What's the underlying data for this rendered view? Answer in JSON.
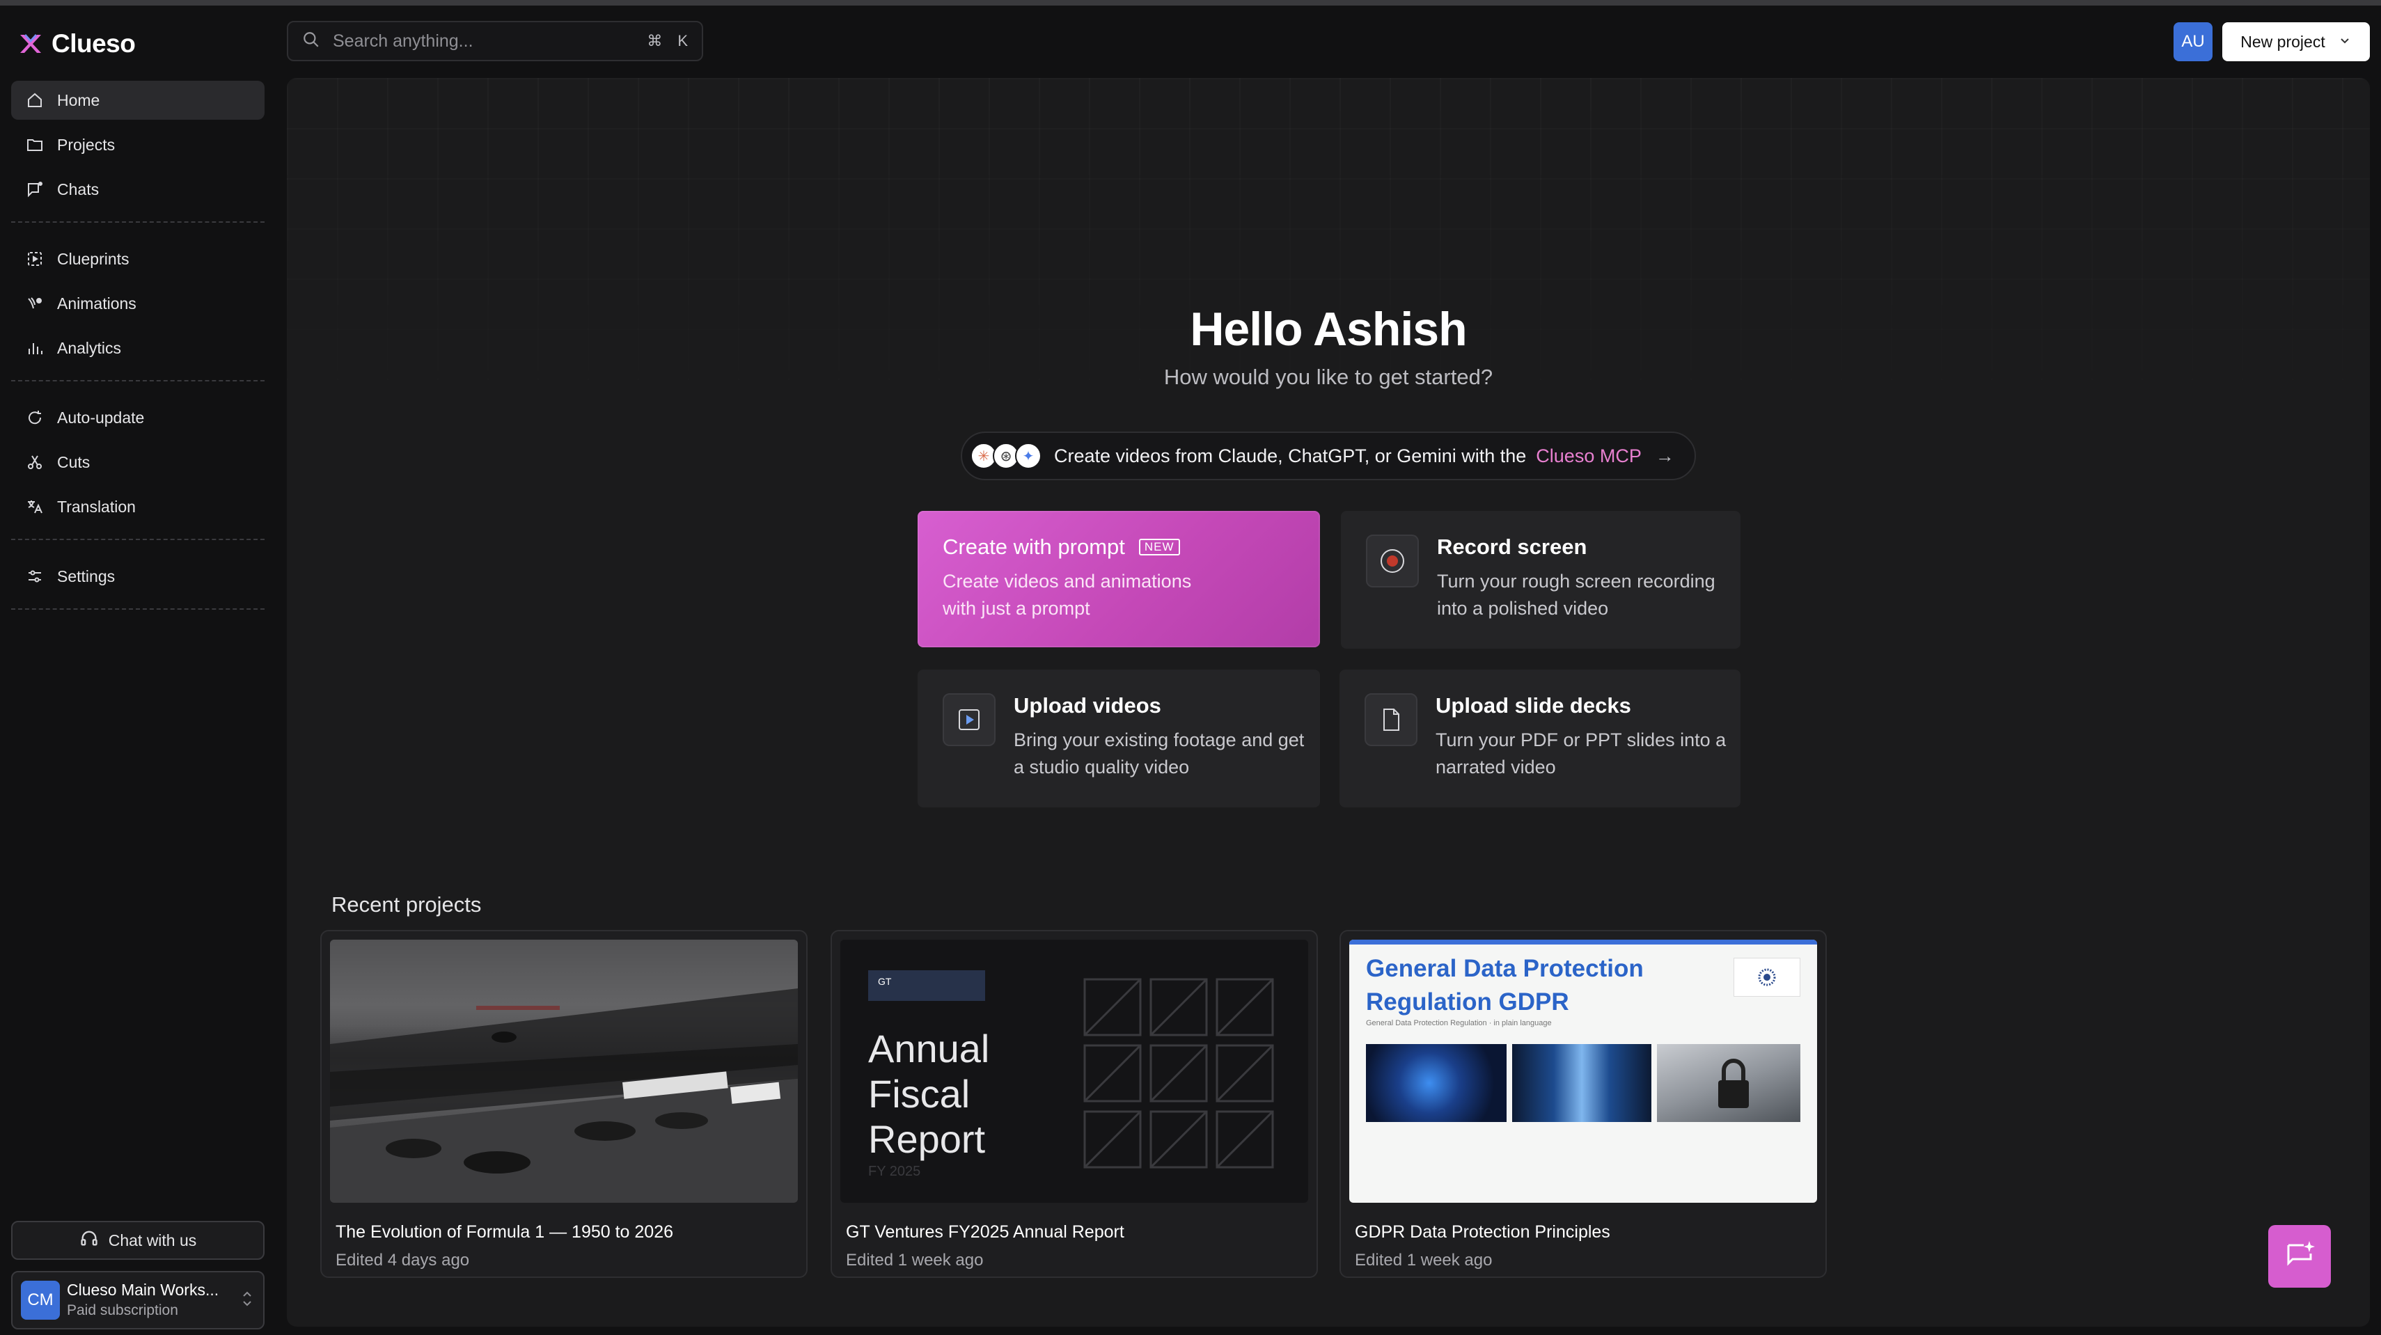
{
  "app": {
    "name": "Clueso"
  },
  "sidebar": {
    "items": [
      {
        "label": "Home",
        "icon": "home-icon",
        "active": true
      },
      {
        "label": "Projects",
        "icon": "folder-icon"
      },
      {
        "label": "Chats",
        "icon": "chat-icon"
      },
      {
        "label": "Clueprints",
        "icon": "clueprint-icon"
      },
      {
        "label": "Animations",
        "icon": "animation-icon"
      },
      {
        "label": "Analytics",
        "icon": "analytics-icon"
      },
      {
        "label": "Auto-update",
        "icon": "refresh-icon"
      },
      {
        "label": "Cuts",
        "icon": "scissors-icon"
      },
      {
        "label": "Translation",
        "icon": "translate-icon"
      },
      {
        "label": "Settings",
        "icon": "sliders-icon"
      }
    ],
    "chat_button": "Chat with us",
    "workspace": {
      "initials": "CM",
      "name": "Clueso Main Works...",
      "plan": "Paid subscription"
    }
  },
  "topbar": {
    "search_placeholder": "Search anything...",
    "shortcut_cmd": "⌘",
    "shortcut_key": "K",
    "user_initials": "AU",
    "new_project_label": "New project"
  },
  "hero": {
    "greeting": "Hello Ashish",
    "subtitle": "How would you like to get started?",
    "mcp_text": "Create videos from Claude, ChatGPT, or Gemini with the",
    "mcp_link": "Clueso MCP"
  },
  "actions": {
    "prompt": {
      "title": "Create with prompt",
      "badge": "NEW",
      "desc": "Create videos and animations with just a prompt"
    },
    "record": {
      "title": "Record screen",
      "desc": "Turn your rough screen recording into a polished video"
    },
    "upload_videos": {
      "title": "Upload videos",
      "desc": "Bring your existing footage and get a studio quality video"
    },
    "upload_slides": {
      "title": "Upload slide decks",
      "desc": "Turn your PDF or PPT slides into a narrated video"
    }
  },
  "recent": {
    "title": "Recent projects",
    "projects": [
      {
        "name": "The Evolution of Formula 1 — 1950 to 2026",
        "edited": "Edited 4 days ago"
      },
      {
        "name": "GT Ventures FY2025 Annual Report",
        "edited": "Edited 1 week ago",
        "thumb_badge": "GT",
        "thumb_title_1": "Annual",
        "thumb_title_2": "Fiscal",
        "thumb_title_3": "Report",
        "thumb_sub": "FY 2025"
      },
      {
        "name": "GDPR Data Protection Principles",
        "edited": "Edited 1 week ago",
        "thumb_title_1": "General Data Protection",
        "thumb_title_2": "Regulation GDPR",
        "thumb_sub": "General Data Protection Regulation · in plain language"
      }
    ]
  },
  "colors": {
    "accent": "#d65dcf",
    "blue": "#3b6fd8",
    "bg": "#111112",
    "panel": "#1b1b1c"
  }
}
